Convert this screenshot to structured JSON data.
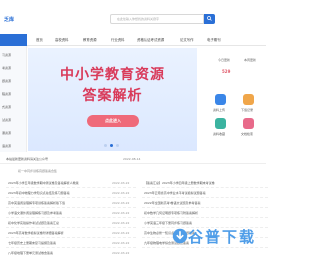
{
  "header": {
    "logo_text": "乏库",
    "search_placeholder": "在此处输入你想找的资料关键字"
  },
  "nav": {
    "items": [
      "首页",
      "高校资料",
      "教育资源",
      "行业资料",
      "资格认证考试资源",
      "论文写作",
      "电子期刊"
    ]
  },
  "sidebar": {
    "items": [
      "习资源",
      "考资源",
      "题资源",
      "程资源",
      "式资源",
      "试资源",
      "课资源",
      "语资源"
    ]
  },
  "banner": {
    "title_line1": "中小学教育资源",
    "title_line2": "答案解析",
    "button": "点此进入"
  },
  "stats": {
    "items": [
      {
        "label": "今日更新",
        "value": "529",
        "color": "#e05a6a"
      },
      {
        "label": "本周更新",
        "value": "—",
        "color": "#2a6fd6"
      }
    ]
  },
  "quick": {
    "items": [
      {
        "label": "资料上传",
        "icon": "upload-icon",
        "color": "#3a86e8"
      },
      {
        "label": "下载记录",
        "icon": "download-icon",
        "color": "#f0a64a"
      },
      {
        "label": "资料收藏",
        "icon": "collect-icon",
        "color": "#3bb3a0"
      },
      {
        "label": "文档检索",
        "icon": "search-doc-icon",
        "color": "#e86a8a"
      }
    ]
  },
  "notice": {
    "text": "本站最新更新资料请关注公众号",
    "date": "2022-08-14"
  },
  "list": {
    "heading": "初一中同步训练真题答案合集",
    "left_rows": [
      {
        "text": "2023年小学五年级数学期中测试卷及答案解析人教版",
        "date": "2022-03-22"
      },
      {
        "text": "2023年初中物理力学知识点总结及练习题答案",
        "date": "2022-03-22"
      },
      {
        "text": "高中英语阅读理解专项训练答案解析版下载",
        "date": "2022-03-22"
      },
      {
        "text": "小学语文课外阅读理解练习题及参考答案",
        "date": "2022-03-22"
      },
      {
        "text": "初中化学实验操作考试试题及答案汇总",
        "date": "2022-03-22"
      },
      {
        "text": "2023年高考数学模拟试卷附详细答案解析",
        "date": "2022-03-22"
      },
      {
        "text": "七年级历史上册期末复习提纲及答案",
        "date": "2022-03-22"
      },
      {
        "text": "八年级地理下册单元测试卷含答案",
        "date": "2022-03-22"
      }
    ],
    "right_rows": [
      {
        "text": "【答案汇总】2023年小学四年级上册数学期末考试卷",
        "date": ""
      },
      {
        "text": "2023年云南省高中学业水平考试模拟试题答案",
        "date": ""
      },
      {
        "text": "2022年全国新高考I卷语文试题及参考答案",
        "date": ""
      },
      {
        "text": "初中数学几何证明题专项练习附答案解析",
        "date": ""
      },
      {
        "text": "小学英语三年级下册同步练习题答案",
        "date": ""
      },
      {
        "text": "高中生物必修一知识点归纳及习题答案",
        "date": ""
      },
      {
        "text": "九年级物理电学综合测试题及答案",
        "date": ""
      },
      {
        "text": "",
        "date": ""
      }
    ]
  },
  "watermark": {
    "text": "谷普下载"
  }
}
